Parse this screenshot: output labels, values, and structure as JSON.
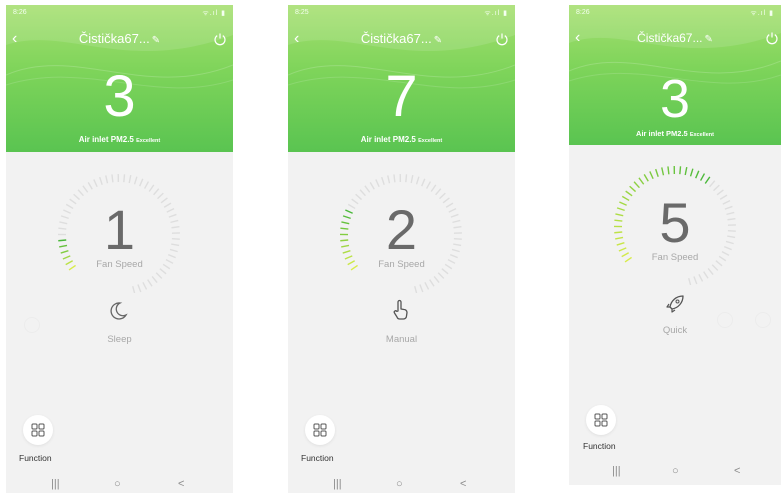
{
  "accent": "#7ed45a",
  "phones": [
    {
      "status_time": "8:26",
      "status_icons": "ᯤ.ıl ▮",
      "device_name": "Čistička67...",
      "pm_value": "3",
      "pm_label": "Air inlet PM2.5",
      "pm_grade": "Excellent",
      "fan_speed": "1",
      "fan_speed_label": "Fan Speed",
      "speed_level": 1,
      "mode_icon": "moon-icon",
      "mode_label": "Sleep",
      "function_label": "Function"
    },
    {
      "status_time": "8:25",
      "status_icons": "ᯤ.ıl ▮",
      "device_name": "Čistička67...",
      "pm_value": "7",
      "pm_label": "Air inlet PM2.5",
      "pm_grade": "Excellent",
      "fan_speed": "2",
      "fan_speed_label": "Fan Speed",
      "speed_level": 2,
      "mode_icon": "hand-icon",
      "mode_label": "Manual",
      "function_label": "Function"
    },
    {
      "status_time": "8:26",
      "status_icons": "ᯤ.ıl ▮",
      "device_name": "Čistička67...",
      "pm_value": "3",
      "pm_label": "Air inlet PM2.5",
      "pm_grade": "Excellent",
      "fan_speed": "5",
      "fan_speed_label": "Fan Speed",
      "speed_level": 5,
      "mode_icon": "rocket-icon",
      "mode_label": "Quick",
      "function_label": "Function"
    }
  ],
  "nav": {
    "recents": "|||",
    "home": "○",
    "back": "<"
  }
}
